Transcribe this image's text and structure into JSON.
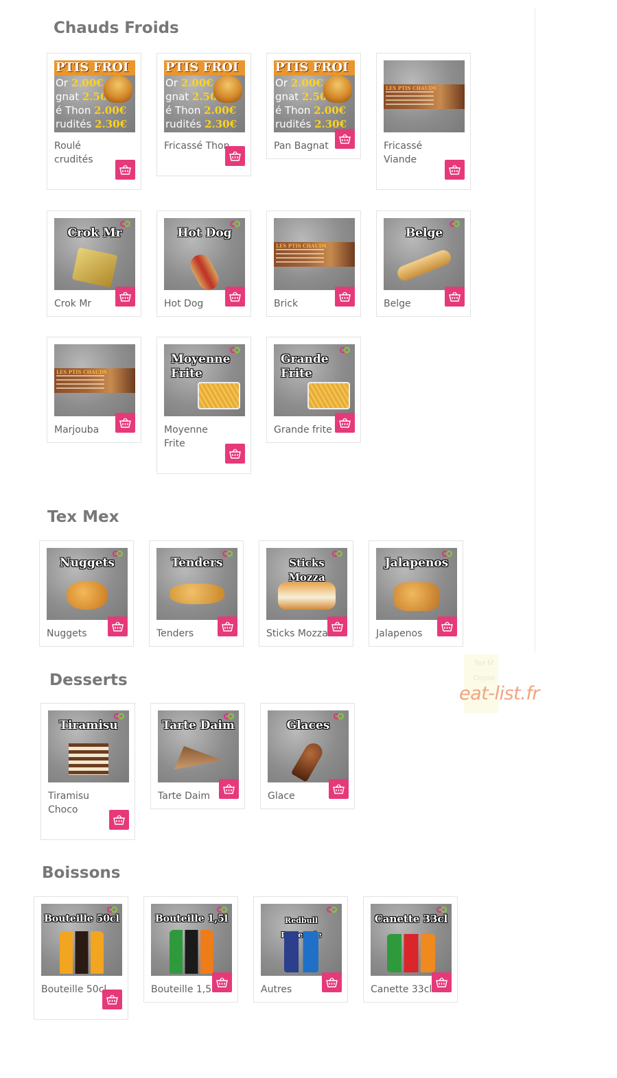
{
  "sections": [
    {
      "title": "Chauds Froids",
      "items": [
        {
          "name": "Roulé crudités",
          "thumb_type": "poster"
        },
        {
          "name": "Fricassé Thon",
          "thumb_type": "poster"
        },
        {
          "name": "Pan Bagnat",
          "thumb_type": "poster"
        },
        {
          "name": "Fricassé Viande",
          "thumb_type": "banner"
        },
        {
          "name": "Crok Mr",
          "thumb_type": "photo",
          "thumb_title": "Crok Mr"
        },
        {
          "name": "Hot Dog",
          "thumb_type": "photo",
          "thumb_title": "Hot Dog"
        },
        {
          "name": "Brick",
          "thumb_type": "banner"
        },
        {
          "name": "Belge",
          "thumb_type": "photo",
          "thumb_title": "Belge"
        },
        {
          "name": "Marjouba",
          "thumb_type": "banner"
        },
        {
          "name": "Moyenne Frite",
          "thumb_type": "photo",
          "thumb_title": "Moyenne\nFrite"
        },
        {
          "name": "Grande frite",
          "thumb_type": "photo",
          "thumb_title": "Grande\nFrite"
        }
      ]
    },
    {
      "title": "Tex Mex",
      "items": [
        {
          "name": "Nuggets",
          "thumb_title": "Nuggets"
        },
        {
          "name": "Tenders",
          "thumb_title": "Tenders"
        },
        {
          "name": "Sticks Mozza",
          "thumb_title": "Sticks Mozza"
        },
        {
          "name": "Jalapenos",
          "thumb_title": "Jalapenos"
        }
      ]
    },
    {
      "title": "Desserts",
      "items": [
        {
          "name": "Tiramisu Choco",
          "thumb_title": "Tiramisu"
        },
        {
          "name": "Tarte Daim",
          "thumb_title": "Tarte Daim"
        },
        {
          "name": "Glace",
          "thumb_title": "Glaces"
        }
      ]
    },
    {
      "title": "Boissons",
      "items": [
        {
          "name": "Bouteille 50cl",
          "thumb_title": "Bouteille 50cl"
        },
        {
          "name": "Bouteille 1,5l",
          "thumb_title": "Bouteille 1,5l"
        },
        {
          "name": "Autres",
          "thumb_title": "Redbull Powerade"
        },
        {
          "name": "Canette 33cl",
          "thumb_title": "Canette 33cl"
        }
      ]
    }
  ],
  "poster": {
    "title": "PTIS FROI",
    "lines": [
      {
        "label": "Or",
        "price": "2.00€"
      },
      {
        "label": "gnat",
        "price": "2.50€"
      },
      {
        "label": "é Thon",
        "price": "2.00€"
      },
      {
        "label": "rudités",
        "price": "2.30€"
      }
    ]
  },
  "banner_title": "LES PTIS CHAUDS",
  "watermark": "eat-list.fr",
  "ghost_text": [
    "Tex M",
    "Desse"
  ],
  "colors": {
    "accent": "#e6397a",
    "logo_pink": "#e0337a",
    "logo_green": "#8cc63f"
  },
  "icons": {
    "cart": "basket-icon",
    "logo": "brand-logo-icon"
  }
}
